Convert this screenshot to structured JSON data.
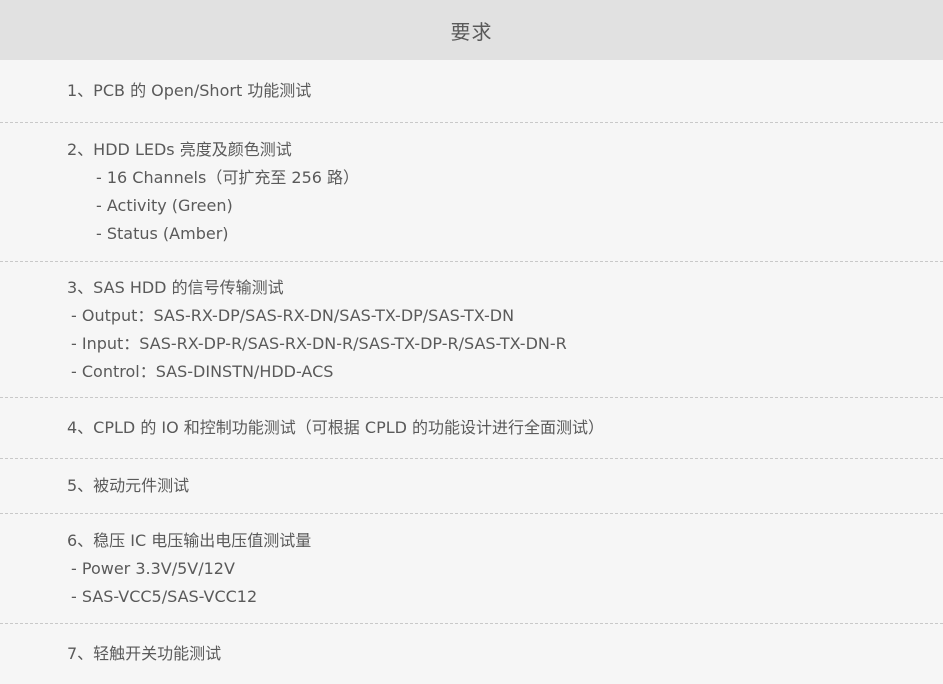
{
  "header": {
    "title": "要求"
  },
  "rows": [
    {
      "title": "1、PCB 的 Open/Short 功能测试",
      "subs": []
    },
    {
      "title": "2、HDD LEDs 亮度及颜色测试",
      "subs": [
        "- 16 Channels（可扩充至 256 路）",
        "- Activity (Green)",
        "- Status (Amber)"
      ]
    },
    {
      "title": "3、SAS HDD 的信号传输测试",
      "subs": [
        "- Output：SAS-RX-DP/SAS-RX-DN/SAS-TX-DP/SAS-TX-DN",
        "- Input：SAS-RX-DP-R/SAS-RX-DN-R/SAS-TX-DP-R/SAS-TX-DN-R",
        "- Control：SAS-DINSTN/HDD-ACS"
      ]
    },
    {
      "title": "4、CPLD 的 IO 和控制功能测试（可根据 CPLD 的功能设计进行全面测试）",
      "subs": []
    },
    {
      "title": "5、被动元件测试",
      "subs": []
    },
    {
      "title": "6、稳压 IC 电压输出电压值测试量",
      "subs": [
        "- Power 3.3V/5V/12V",
        "- SAS-VCC5/SAS-VCC12"
      ]
    },
    {
      "title": "7、轻触开关功能测试",
      "subs": []
    }
  ]
}
